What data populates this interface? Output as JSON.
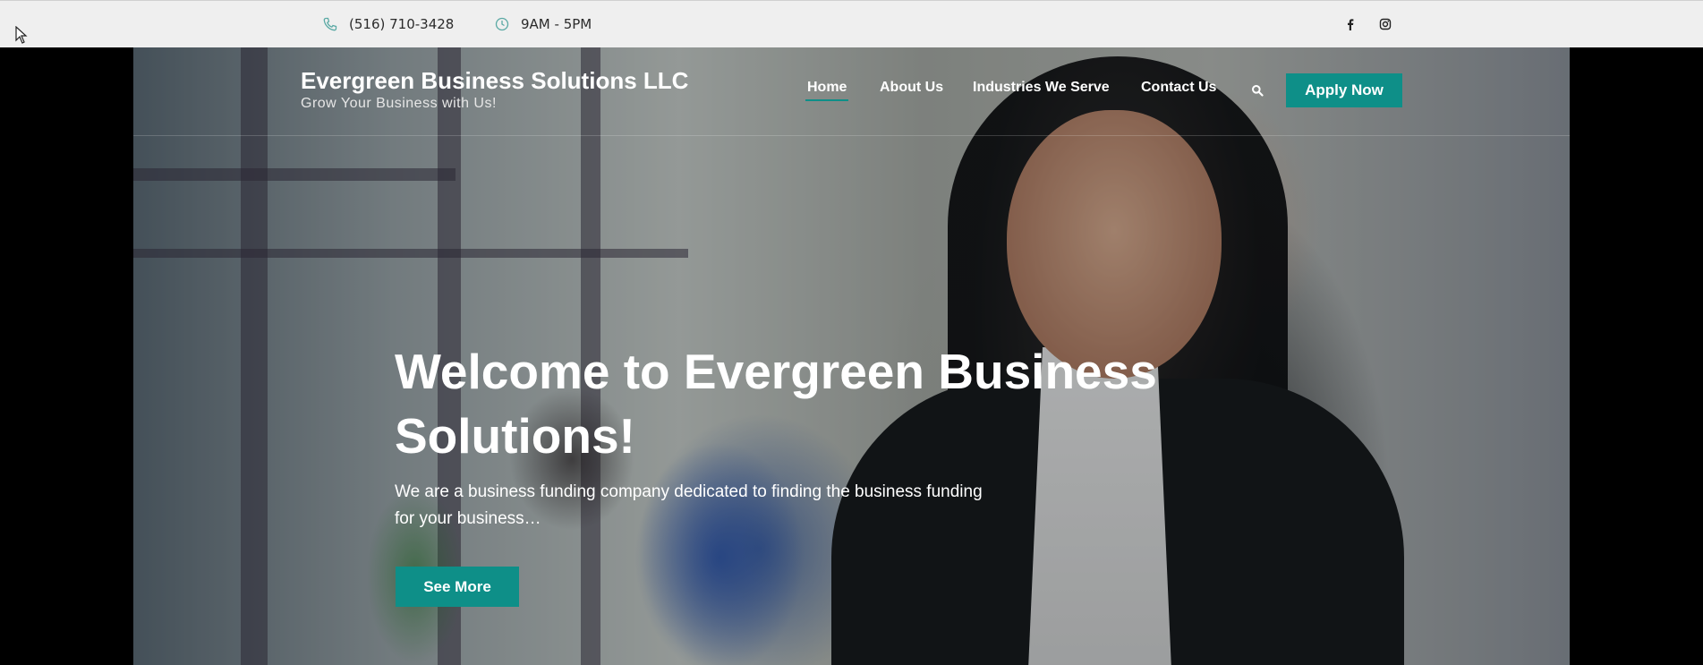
{
  "topbar": {
    "phone": "(516) 710-3428",
    "hours": "9AM - 5PM",
    "icons": [
      "phone-icon",
      "clock-icon",
      "facebook-icon",
      "instagram-icon"
    ]
  },
  "header": {
    "brand_title": "Evergreen Business Solutions LLC",
    "brand_tagline": "Grow Your Business with Us!",
    "nav": [
      {
        "label": "Home",
        "active": true
      },
      {
        "label": "About Us"
      },
      {
        "label": "Industries We Serve"
      },
      {
        "label": "Contact Us"
      }
    ],
    "apply_label": "Apply Now"
  },
  "hero": {
    "headline": "Welcome to Evergreen Business Solutions!",
    "lead": "We are a business funding company dedicated to finding the business funding for your business…",
    "cta_label": "See More"
  },
  "colors": {
    "accent": "#0e8f88",
    "topbar_bg": "#efefef",
    "icon_teal": "#5aa9a4"
  }
}
